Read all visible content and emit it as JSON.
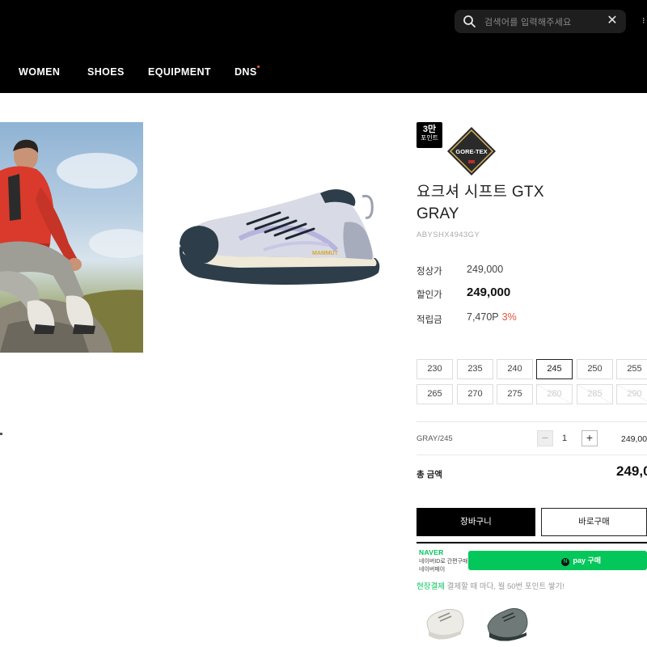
{
  "header": {
    "search": {
      "placeholder": "검색어를 입력해주세요"
    },
    "nav": [
      {
        "label": "WOMEN"
      },
      {
        "label": "SHOES"
      },
      {
        "label": "EQUIPMENT"
      },
      {
        "label": "DNS"
      }
    ]
  },
  "product": {
    "points_badge": {
      "line1": "3만",
      "line2": "포인트"
    },
    "goretex_badge_text": "GORE-TEX",
    "title_line1": "요크셔 시프트 GTX",
    "title_line2": "GRAY",
    "sku": "ABYSHX4943GY",
    "regular_price_label": "정상가",
    "regular_price": "249,000",
    "sale_price_label": "할인가",
    "sale_price": "249,000",
    "points_label": "적립금",
    "points_value": "7,470P",
    "points_rate": "3%"
  },
  "sizes": [
    {
      "label": "230",
      "state": "available"
    },
    {
      "label": "235",
      "state": "available"
    },
    {
      "label": "240",
      "state": "available"
    },
    {
      "label": "245",
      "state": "selected"
    },
    {
      "label": "250",
      "state": "available"
    },
    {
      "label": "255",
      "state": "available"
    },
    {
      "label": "265",
      "state": "available"
    },
    {
      "label": "270",
      "state": "available"
    },
    {
      "label": "275",
      "state": "available"
    },
    {
      "label": "280",
      "state": "soldout"
    },
    {
      "label": "285",
      "state": "soldout"
    },
    {
      "label": "290",
      "state": "soldout"
    }
  ],
  "option": {
    "name": "GRAY/245",
    "minus": "−",
    "quantity": "1",
    "plus": "+",
    "price": "249,00"
  },
  "total": {
    "label": "총 금액",
    "value": "249,0"
  },
  "actions": {
    "cart": "장바구니",
    "buy": "바로구매"
  },
  "naver": {
    "logo": "NAVER",
    "line1": "네이버ID로 간편구매",
    "line2": "네이버페이",
    "pay_icon": "N",
    "pay_label": "pay 구매"
  },
  "promo": {
    "highlight": "현장결제",
    "rest": " 결제할 때 마다, 월 50번 포인트 쌓기!"
  },
  "colors": {
    "naver_green": "#03c75a",
    "rate_red": "#e5533d",
    "header_bg": "#000000"
  }
}
